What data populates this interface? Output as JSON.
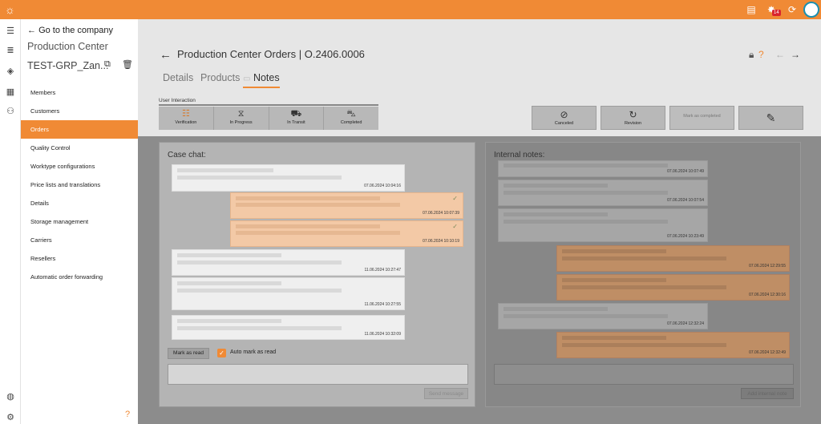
{
  "topbar": {
    "icons": [
      "sun-logo-icon",
      "chat-icon",
      "notifications-icon",
      "refresh-icon",
      "user-avatar"
    ],
    "notification_count": "14"
  },
  "rail": {
    "icons": [
      "hamburger-menu-icon",
      "list-icon",
      "tag-icon",
      "grid-icon",
      "users-icon",
      "globe-icon",
      "settings-icon"
    ]
  },
  "sidebar": {
    "goto_label": "Go to the company",
    "title": "Production Center",
    "company": "TEST-GRP_Zan...",
    "menu": [
      "Members",
      "Customers",
      "Orders",
      "Quality Control",
      "Worktype configurations",
      "Price lists and translations",
      "Details",
      "Storage management",
      "Carriers",
      "Resellers",
      "Automatic order forwarding"
    ],
    "active_index": 2,
    "help": "?"
  },
  "header": {
    "title": "Production Center Orders | O.2406.0006",
    "help": "?"
  },
  "tabs": [
    "Details",
    "Products",
    "Notes"
  ],
  "active_tab": "Notes",
  "workflow": {
    "label": "User Interaction",
    "steps": [
      "Verification",
      "In Progress",
      "In Transit",
      "Completed"
    ],
    "actions": [
      "Canceled",
      "Revision",
      "Mark as completed"
    ]
  },
  "case_chat": {
    "title": "Case chat:",
    "messages": [
      {
        "side": "in",
        "time": "07.06.2024 10:04:16"
      },
      {
        "side": "out",
        "time": "07.06.2024 10:07:39",
        "check": "✓"
      },
      {
        "side": "out",
        "time": "07.06.2024 10:10:19",
        "check": "✓"
      },
      {
        "side": "in",
        "time": "11.06.2024 10:27:47"
      },
      {
        "side": "in",
        "time": "11.06.2024 10:27:55"
      },
      {
        "side": "in",
        "time": "11.06.2024 10:32:09"
      }
    ],
    "mark_as_read": "Mark as read",
    "auto_mark_as_read": "Auto mark as read",
    "send": "Send message"
  },
  "internal_notes": {
    "title": "Internal notes:",
    "notes": [
      {
        "side": "in",
        "time": "07.06.2024 10:07:49"
      },
      {
        "side": "in",
        "time": "07.06.2024 10:07:54"
      },
      {
        "side": "in",
        "time": "07.06.2024 10:23:49"
      },
      {
        "side": "out",
        "time": "07.06.2024 12:29:55"
      },
      {
        "side": "out",
        "time": "07.06.2024 12:30:16"
      },
      {
        "side": "in",
        "time": "07.06.2024 12:32:24"
      },
      {
        "side": "out",
        "time": "07.06.2024 12:32:49"
      }
    ],
    "add": "Add internal note"
  }
}
